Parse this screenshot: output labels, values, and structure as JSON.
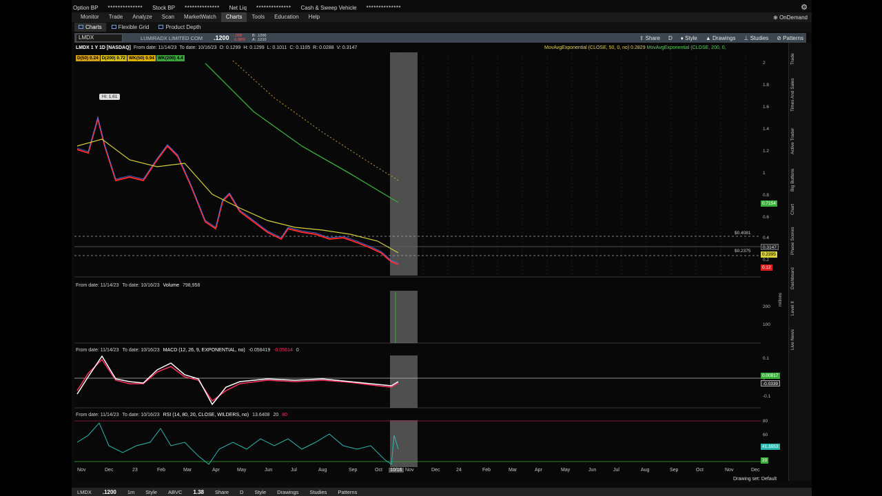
{
  "topbar": {
    "option_bp_label": "Option BP",
    "option_bp_value": "**************",
    "stock_bp_label": "Stock BP",
    "stock_bp_value": "**************",
    "net_liq_label": "Net Liq",
    "net_liq_value": "**************",
    "cash_label": "Cash & Sweep Vehicle",
    "cash_value": "**************"
  },
  "menu": [
    "Monitor",
    "Trade",
    "Analyze",
    "Scan",
    "MarketWatch",
    "Charts",
    "Tools",
    "Education",
    "Help"
  ],
  "menu_active": "Charts",
  "ondemand": "OnDemand",
  "subtabs": [
    "Charts",
    "Flexible Grid",
    "Product Depth"
  ],
  "toolbar": {
    "symbol": "LMDX",
    "company": "LUMIRADX LIMITED COM",
    "price": ".1200",
    "change_1": "-.009",
    "change_2": "-6.98%",
    "bid": "B: .1200",
    "ask": "A: .1210",
    "buttons": [
      "Share",
      "D",
      "Style",
      "Drawings",
      "Studies",
      "Patterns"
    ]
  },
  "info": {
    "ticker": "LMDX 1 Y 1D [NASDAQ]",
    "from": "From date: 11/14/23",
    "to": "To date: 10/16/23",
    "ohlc": [
      "O: 0.1299",
      "H: 0.1299",
      "L: 0.1011",
      "C: 0.1105",
      "R: 0.0288",
      "V: 0.3147"
    ],
    "study1": "MovAvgExponential (CLOSE, 50, 0, no)",
    "study1_val": "0.2829",
    "study2": "MovAvgExponential (CLOSE, 200, 0,"
  },
  "ma_labels": [
    {
      "text": "D(50) 0.24",
      "bg": "#d4a017",
      "fg": "#000"
    },
    {
      "text": "D(200) 0.72",
      "bg": "#d4c017",
      "fg": "#000"
    },
    {
      "text": "WK(50) 0.94",
      "bg": "#e0b000",
      "fg": "#000"
    },
    {
      "text": "WK(200) 4.4",
      "bg": "#3aa53a",
      "fg": "#000"
    }
  ],
  "hi_label": "Hi: 1.61",
  "price_axis": [
    "2",
    "1.8",
    "1.6",
    "1.4",
    "1.2",
    "1",
    "0.8",
    "0.6",
    "0.4",
    "0.2"
  ],
  "price_tags": {
    "t1": "0.7154",
    "t2": "0.3147",
    "t3": "0.2395",
    "t4": "0.12"
  },
  "price_levels": {
    "l1": "$0.4081",
    "l2": "$0.2375"
  },
  "volume_pane": {
    "from": "From date: 11/14/23",
    "to": "To date: 10/16/23",
    "label": "Volume",
    "value": "798,958",
    "axis": [
      "200",
      "100"
    ],
    "unit": "millions"
  },
  "macd_pane": {
    "from": "From date: 11/14/23",
    "to": "To date: 10/16/23",
    "label": "MACD (12, 26, 9, EXPONENTIAL, no)",
    "value": "-0.058419",
    "v2": "-0.05614",
    "v3": "0",
    "axis": [
      "0.1",
      "0",
      "-0.1"
    ],
    "tag1": "0.00817",
    "tag2": "-0.0339"
  },
  "rsi_pane": {
    "from": "From date: 11/14/23",
    "to": "To date: 10/16/23",
    "label": "RSI (14, 80, 20, CLOSE, WILDERS, no)",
    "value": "13.6408",
    "v2": "20",
    "v3": "80",
    "axis": [
      "80",
      "60",
      "40",
      "20"
    ],
    "tag1": "41.3953",
    "tag2": "20"
  },
  "x_axis": [
    "Nov",
    "Dec",
    "23",
    "Feb",
    "Mar",
    "Apr",
    "May",
    "Jun",
    "Jul",
    "Aug",
    "Sep",
    "Oct",
    "10/16",
    "Nov",
    "Dec",
    "24",
    "Feb",
    "Mar",
    "Apr",
    "May",
    "Jun",
    "Jul",
    "Aug",
    "Sep",
    "Oct",
    "Nov",
    "Dec"
  ],
  "sidebar": [
    "Trade",
    "Times And Sales",
    "Active Trader",
    "Big Buttons",
    "Chart",
    "Phase Scores",
    "Dashboard",
    "Level II",
    "Live News"
  ],
  "status": "Drawing set: Default",
  "bottom": {
    "sym1": "LMDX",
    "price1": ".1200",
    "sym2": "ABVC",
    "price2": "1.38",
    "items": [
      "1m",
      "Style",
      "Share",
      "D",
      "Style",
      "Drawings",
      "Studies",
      "Patterns"
    ]
  },
  "colors": {
    "candles_up": "#3c78ff",
    "candles_down": "#ff2a2a",
    "ema50": "#d6d03a",
    "ema200": "#3ab03a",
    "rsi": "#2ab8b0",
    "macd": "#ffffff",
    "signal": "#ff3060"
  }
}
